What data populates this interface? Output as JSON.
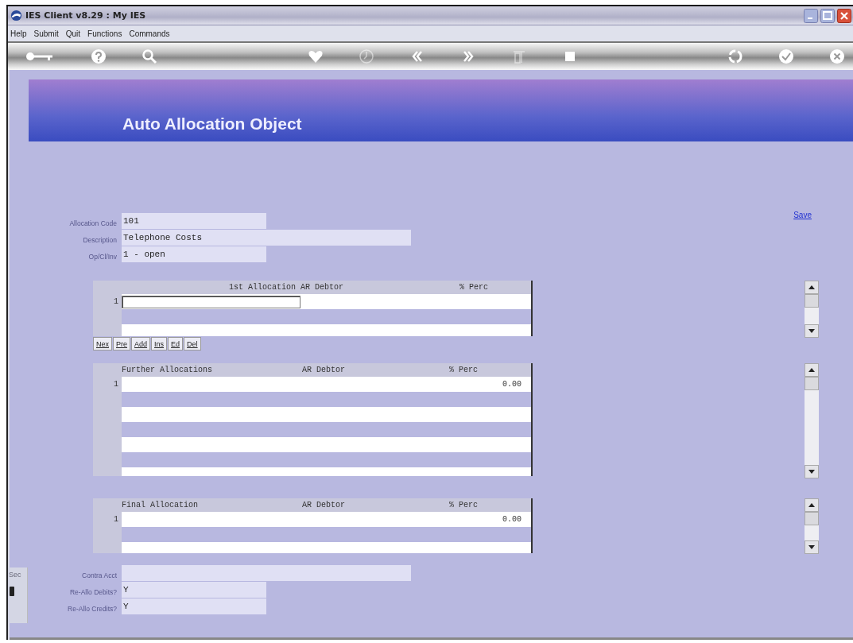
{
  "window": {
    "title": "IES Client v8.29 : My IES"
  },
  "menu": [
    "Help",
    "Submit",
    "Quit",
    "Functions",
    "Commands"
  ],
  "header": {
    "title": "Auto Allocation Object"
  },
  "save_link": "Save",
  "fields": [
    {
      "label": "Allocation Code",
      "value": "101",
      "kind": "short"
    },
    {
      "label": "Description",
      "value": "Telephone Costs",
      "kind": "long"
    },
    {
      "label": "Op/Cl/Inv",
      "value": "1 - open",
      "kind": "short"
    }
  ],
  "grids": [
    {
      "columns": [
        "1st Allocation AR Debtor",
        "% Perc"
      ],
      "rows": [
        {
          "number": "1",
          "kind": "edit"
        }
      ],
      "buttons": [
        "Nex",
        "Pre",
        "Add",
        "Ins",
        "Ed",
        "Del"
      ]
    },
    {
      "columns": [
        "Further Allocations",
        "AR Debtor",
        "% Perc"
      ],
      "rows": [
        {
          "number": "1",
          "kind": "value",
          "perc": "0.00"
        }
      ]
    },
    {
      "columns": [
        "Final Allocation",
        "AR Debtor",
        "% Perc"
      ],
      "rows": [
        {
          "number": "1",
          "kind": "value",
          "perc": "0.00"
        }
      ]
    }
  ],
  "bottom_fields": [
    {
      "label": "Contra Acct",
      "kind": "long"
    },
    {
      "label": "Re-Allo Debits?",
      "value": "Y",
      "kind": "short"
    },
    {
      "label": "Re-Allo Credits?",
      "value": "Y",
      "kind": "short"
    }
  ],
  "side_panel": {
    "label": "Sec"
  }
}
